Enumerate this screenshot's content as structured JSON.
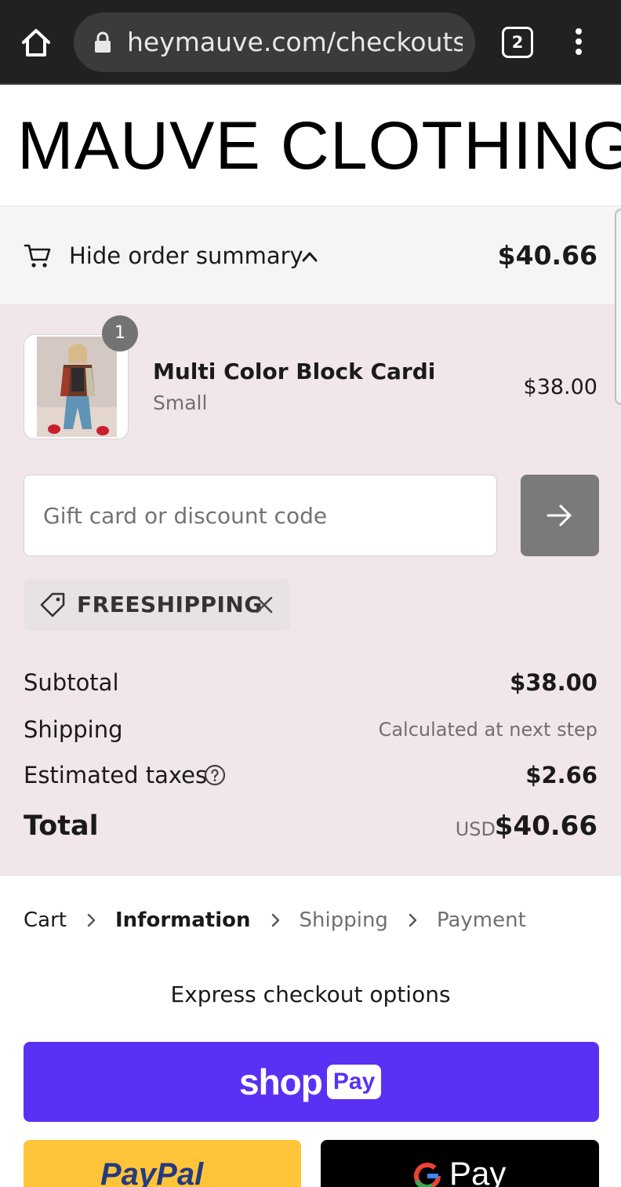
{
  "browser": {
    "url": "heymauve.com/checkouts/c/",
    "tab_count": "2"
  },
  "store": {
    "name": "MAUVE CLOTHING"
  },
  "summary_toggle": {
    "label": "Hide order summary",
    "total": "$40.66"
  },
  "line_item": {
    "quantity": "1",
    "name": "Multi Color Block Cardi",
    "variant": "Small",
    "price": "$38.00"
  },
  "discount": {
    "placeholder": "Gift card or discount code",
    "applied_code": "FREESHIPPING"
  },
  "totals": {
    "subtotal_label": "Subtotal",
    "subtotal_value": "$38.00",
    "shipping_label": "Shipping",
    "shipping_value": "Calculated at next step",
    "taxes_label": "Estimated taxes",
    "taxes_value": "$2.66",
    "total_label": "Total",
    "currency": "USD",
    "total_value": "$40.66"
  },
  "breadcrumb": {
    "steps": [
      "Cart",
      "Information",
      "Shipping",
      "Payment"
    ],
    "current": "Information"
  },
  "express": {
    "title": "Express checkout options",
    "shop_pay_shop": "shop",
    "shop_pay_pay": "Pay",
    "paypal": "PayPal",
    "gpay": "Pay"
  },
  "colors": {
    "summary_bg": "#f1e6ea",
    "shop_pay": "#5a31f4",
    "paypal": "#ffc439",
    "gpay": "#000000"
  }
}
